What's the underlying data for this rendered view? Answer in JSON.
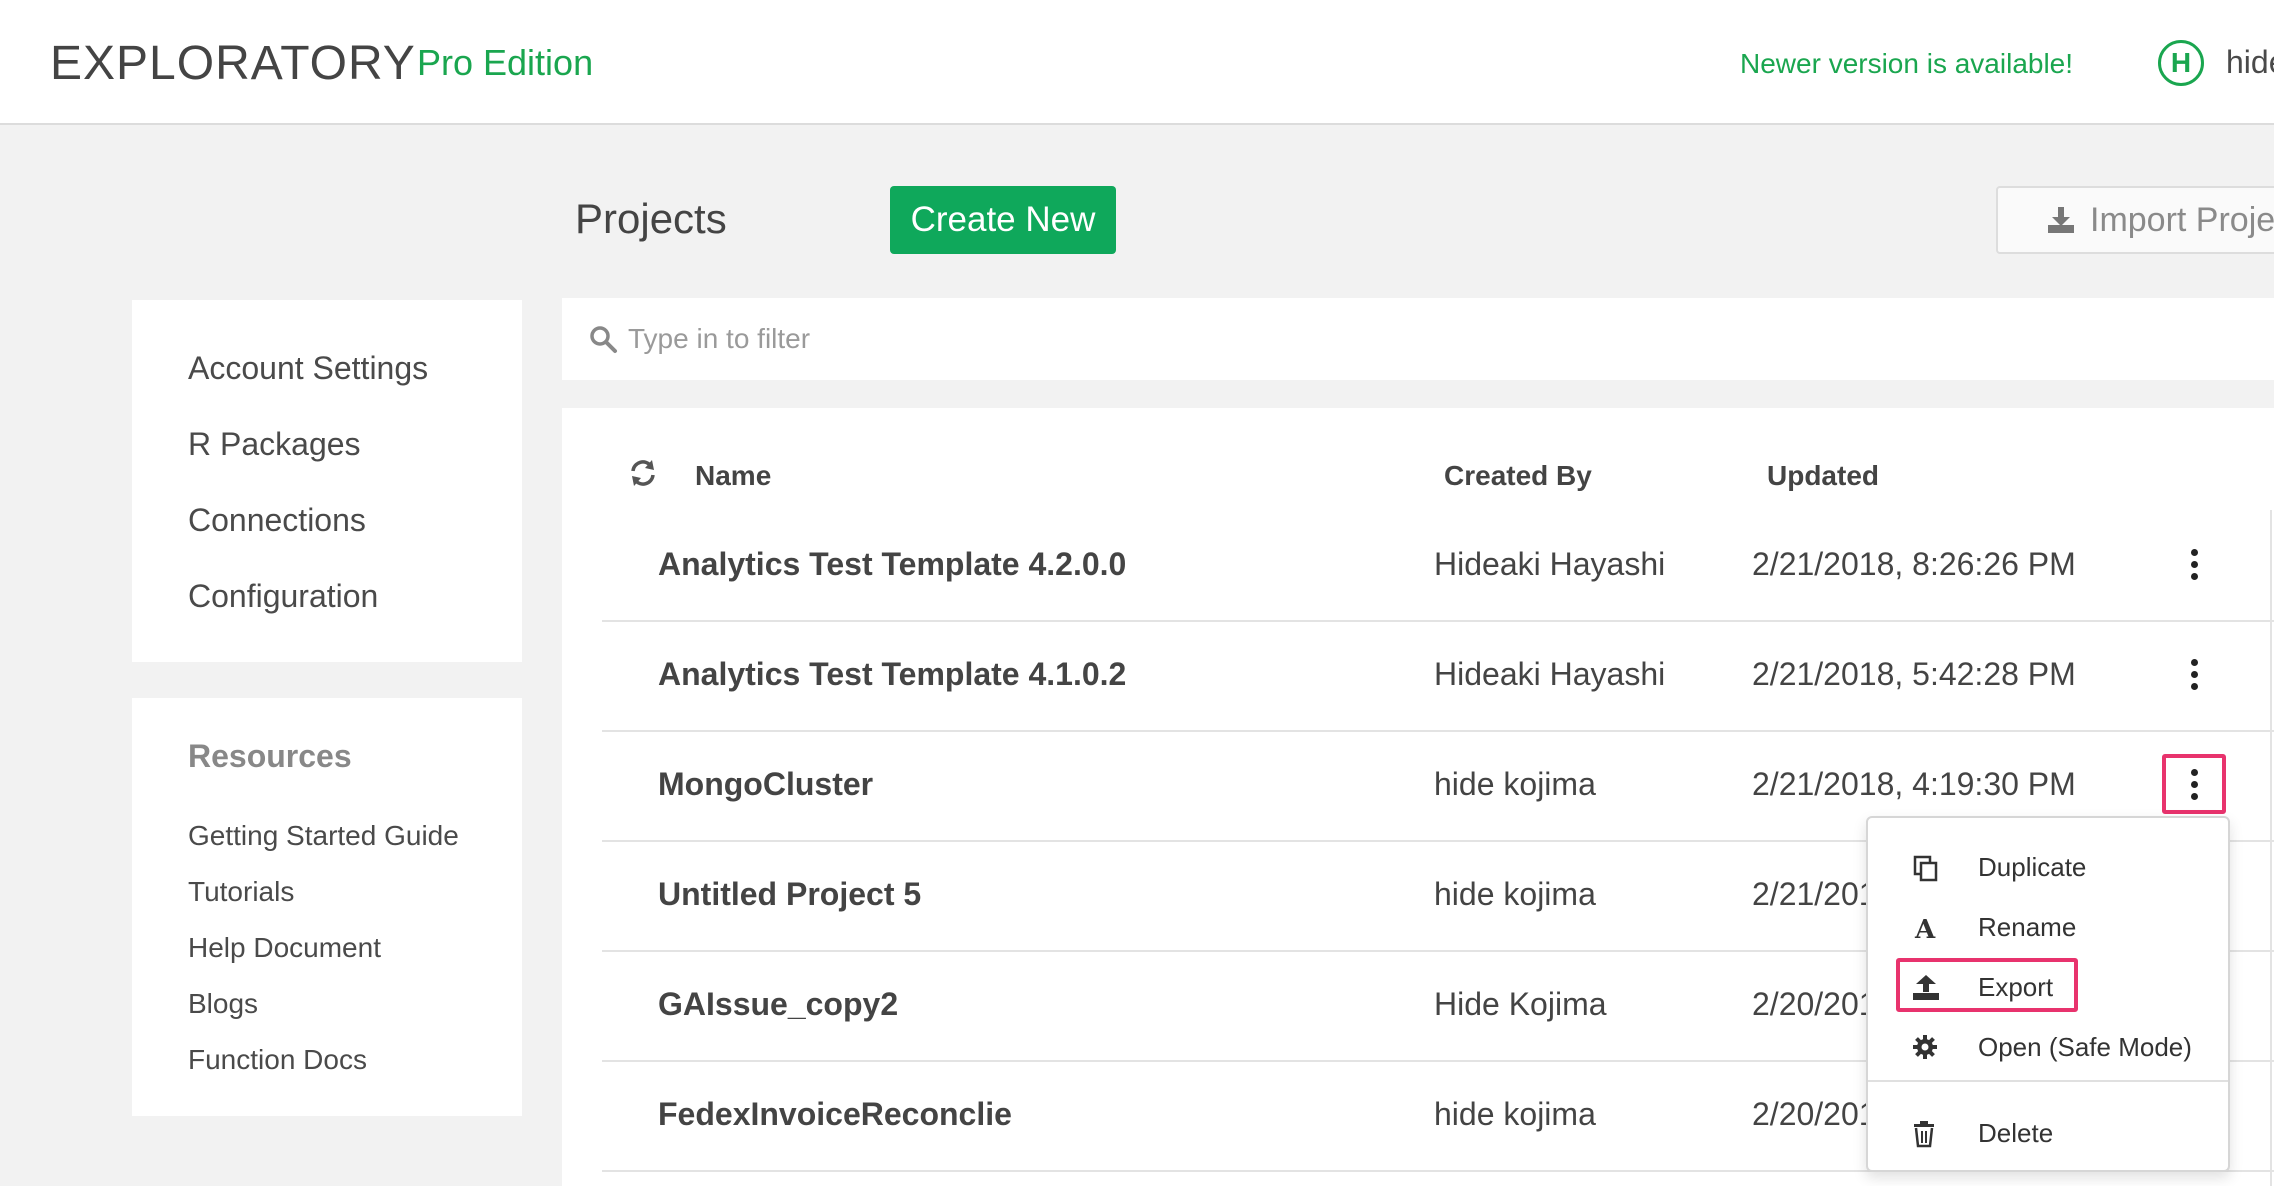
{
  "app": {
    "logo": "EXPLORATORY",
    "edition": "Pro Edition",
    "update_notice": "Newer version is available!",
    "avatar_initial": "H",
    "username": "hide"
  },
  "colors": {
    "accent": "#1aa64f",
    "button": "#0fa85b",
    "highlight": "#e8336d"
  },
  "header": {
    "title": "Projects",
    "create_label": "Create New",
    "import_label": "Import Project"
  },
  "sidebar": {
    "settings": [
      "Account Settings",
      "R Packages",
      "Connections",
      "Configuration"
    ],
    "resources_title": "Resources",
    "resources": [
      "Getting Started Guide",
      "Tutorials",
      "Help Document",
      "Blogs",
      "Function Docs"
    ]
  },
  "filter": {
    "placeholder": "Type in to filter"
  },
  "table": {
    "columns": {
      "name": "Name",
      "created_by": "Created By",
      "updated": "Updated"
    },
    "rows": [
      {
        "name": "Analytics Test Template 4.2.0.0",
        "created_by": "Hideaki Hayashi",
        "updated": "2/21/2018, 8:26:26 PM"
      },
      {
        "name": "Analytics Test Template 4.1.0.2",
        "created_by": "Hideaki Hayashi",
        "updated": "2/21/2018, 5:42:28 PM"
      },
      {
        "name": "MongoCluster",
        "created_by": "hide kojima",
        "updated": "2/21/2018, 4:19:30 PM"
      },
      {
        "name": "Untitled Project 5",
        "created_by": "hide kojima",
        "updated": "2/21/201"
      },
      {
        "name": "GAIssue_copy2",
        "created_by": "Hide Kojima",
        "updated": "2/20/201"
      },
      {
        "name": "FedexInvoiceReconclie",
        "created_by": "hide kojima",
        "updated": "2/20/201"
      }
    ]
  },
  "context_menu": {
    "items": [
      {
        "label": "Duplicate",
        "icon": "copy-icon"
      },
      {
        "label": "Rename",
        "icon": "rename-icon"
      },
      {
        "label": "Export",
        "icon": "export-icon"
      },
      {
        "label": "Open (Safe Mode)",
        "icon": "gear-icon"
      },
      {
        "label": "Delete",
        "icon": "trash-icon"
      }
    ]
  }
}
